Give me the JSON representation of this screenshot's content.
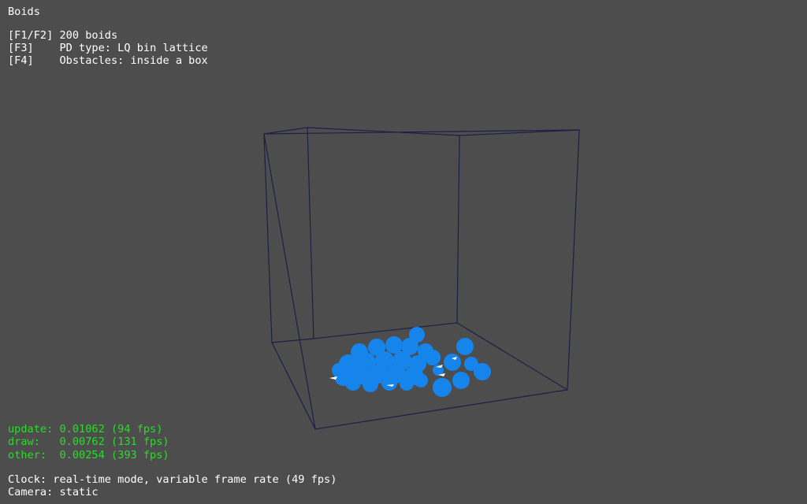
{
  "app": {
    "title": "Boids"
  },
  "controls": [
    {
      "key": "[F1/F2]",
      "value": "200 boids"
    },
    {
      "key": "[F3]",
      "value": "PD type: LQ bin lattice"
    },
    {
      "key": "[F4]",
      "value": "Obstacles: inside a box"
    }
  ],
  "timing": [
    {
      "label": "update:",
      "value": "0.01062 (94 fps)"
    },
    {
      "label": "draw:",
      "value": "0.00762 (131 fps)"
    },
    {
      "label": "other:",
      "value": "0.00254 (393 fps)"
    }
  ],
  "status": {
    "clock": "Clock: real-time mode, variable frame rate (49 fps)",
    "camera": "Camera: static"
  },
  "colors": {
    "background": "#4d4d4d",
    "box_edges": "#1d1f45",
    "boid_fill": "#1585ec",
    "hud_text": "#ffffff",
    "timing_text": "#28dd28"
  }
}
